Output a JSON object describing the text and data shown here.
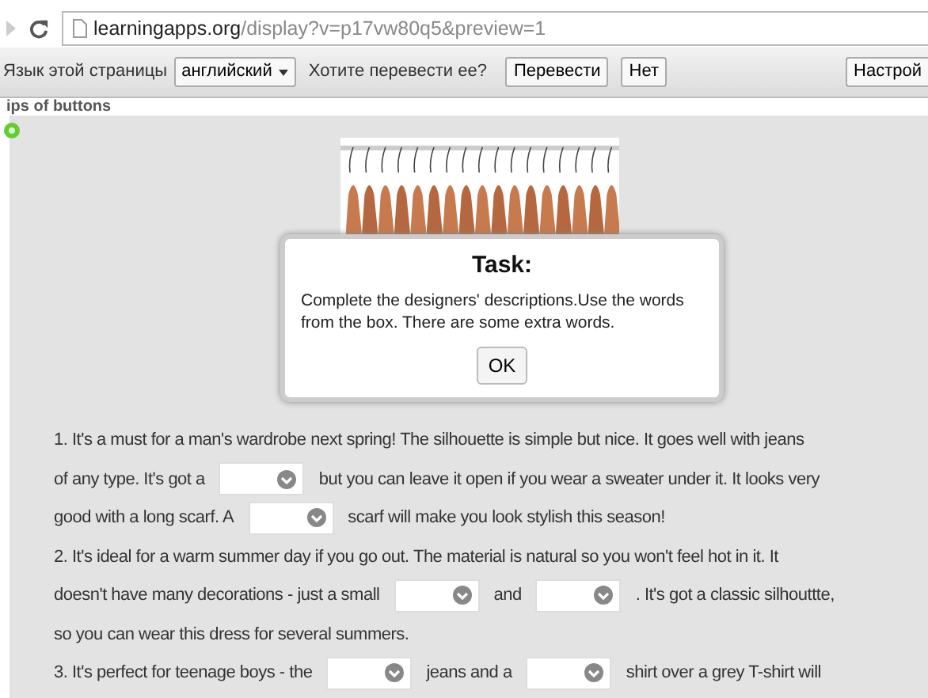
{
  "browser": {
    "url_host": "learningapps.org",
    "url_path": "/display?v=p17vw80q5&preview=1"
  },
  "translate_bar": {
    "label": "Язык этой страницы",
    "language": "английский",
    "question": "Хотите перевести ее?",
    "buttons": [
      "Перевести",
      "Нет"
    ],
    "settings_button": "Настрой"
  },
  "page": {
    "title": "ips of buttons"
  },
  "dialog": {
    "title": "Task:",
    "text": "Complete the designers' descriptions.Use the words from the box. There are some extra words.",
    "button": "OK"
  },
  "paragraphs": [
    [
      [
        {
          "kind": "text",
          "text": "1. It's a must for a man's wardrobe next spring! The silhouette is simple but nice. It goes well with jeans"
        }
      ],
      [
        {
          "kind": "text",
          "text": "of any type. It's got a"
        },
        {
          "kind": "dropdown"
        },
        {
          "kind": "text",
          "text": "but you can leave it open if you wear a sweater under it. It looks very"
        }
      ],
      [
        {
          "kind": "text",
          "text": "good with a long scarf. A"
        },
        {
          "kind": "dropdown"
        },
        {
          "kind": "text",
          "text": "scarf will make you look stylish this season!"
        }
      ]
    ],
    [
      [
        {
          "kind": "text",
          "text": "2. It's ideal for a warm summer day if you go out. The material is natural so you won't feel hot in it. It"
        }
      ],
      [
        {
          "kind": "text",
          "text": "doesn't have many decorations - just a small"
        },
        {
          "kind": "dropdown"
        },
        {
          "kind": "text",
          "text": "and"
        },
        {
          "kind": "dropdown"
        },
        {
          "kind": "text",
          "text": ". It's got a classic silhouttte,"
        }
      ],
      [
        {
          "kind": "text",
          "text": "so you can wear this dress for several summers."
        }
      ]
    ],
    [
      [
        {
          "kind": "text",
          "text": "3. It's perfect for teenage boys - the"
        },
        {
          "kind": "dropdown"
        },
        {
          "kind": "text",
          "text": "jeans and a"
        },
        {
          "kind": "dropdown"
        },
        {
          "kind": "text",
          "text": "shirt over a grey T-shirt will"
        }
      ]
    ]
  ]
}
